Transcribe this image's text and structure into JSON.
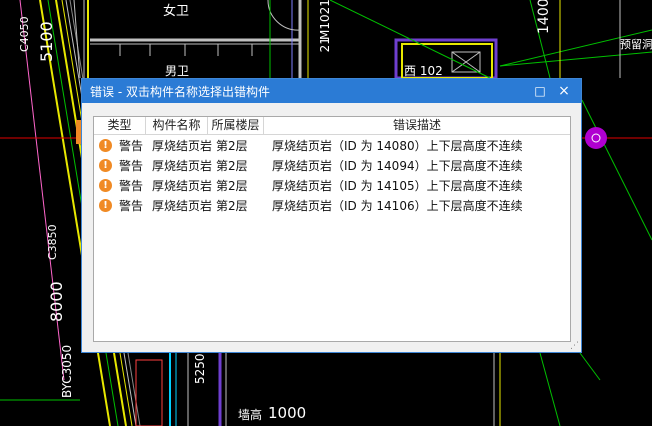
{
  "cad": {
    "labels": [
      "5100",
      "C4050",
      "女卫",
      "M1021",
      "M1021",
      "男卫",
      "1400",
      "预留洞",
      "西 102",
      "C3850",
      "8000",
      "BYC3050",
      "5250",
      "墙高",
      "1000"
    ]
  },
  "dialog": {
    "title": "错误 - 双击构件名称选择出错构件",
    "maximize_glyph": "□",
    "close_glyph": "×",
    "columns": [
      "类型",
      "构件名称",
      "所属楼层",
      "错误描述"
    ],
    "rows": [
      {
        "type": "警告",
        "name": "厚烧结页岩",
        "floor": "第2层",
        "desc": "厚烧结页岩（ID 为 14080）上下层高度不连续"
      },
      {
        "type": "警告",
        "name": "厚烧结页岩",
        "floor": "第2层",
        "desc": "厚烧结页岩（ID 为 14094）上下层高度不连续"
      },
      {
        "type": "警告",
        "name": "厚烧结页岩",
        "floor": "第2层",
        "desc": "厚烧结页岩（ID 为 14105）上下层高度不连续"
      },
      {
        "type": "警告",
        "name": "厚烧结页岩",
        "floor": "第2层",
        "desc": "厚烧结页岩（ID 为 14106）上下层高度不连续"
      }
    ],
    "warning_glyph": "!"
  }
}
